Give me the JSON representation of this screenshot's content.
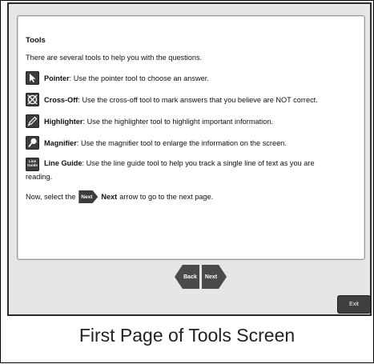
{
  "panel": {
    "title": "Tools",
    "intro": "There are several tools to help you with the questions.",
    "tools": [
      {
        "name": "Pointer",
        "desc": ": Use the pointer tool to choose an answer."
      },
      {
        "name": "Cross-Off",
        "desc": ": Use the cross-off tool to mark answers that you believe are NOT correct."
      },
      {
        "name": "Highlighter",
        "desc": ": Use the highlighter tool to highlight important information."
      },
      {
        "name": "Magnifier",
        "desc": ": Use the magnifier tool to enlarge the information on the screen."
      },
      {
        "name": "Line Guide",
        "desc": ": Use the line guide tool to help you track a single line of text as you are",
        "desc_cont": "reading.",
        "icon_text": "Line\nGuide"
      }
    ],
    "final": {
      "prefix": "Now, select the",
      "inline_button": "Next",
      "bold": "Next",
      "suffix": "arrow to go to the next page."
    }
  },
  "nav": {
    "back_label": "Back",
    "next_label": "Next",
    "exit_label": "Exit"
  },
  "caption": "First Page of Tools Screen",
  "icons": [
    "pointer-icon",
    "cross-off-icon",
    "highlighter-icon",
    "magnifier-icon",
    "line-guide-icon"
  ]
}
